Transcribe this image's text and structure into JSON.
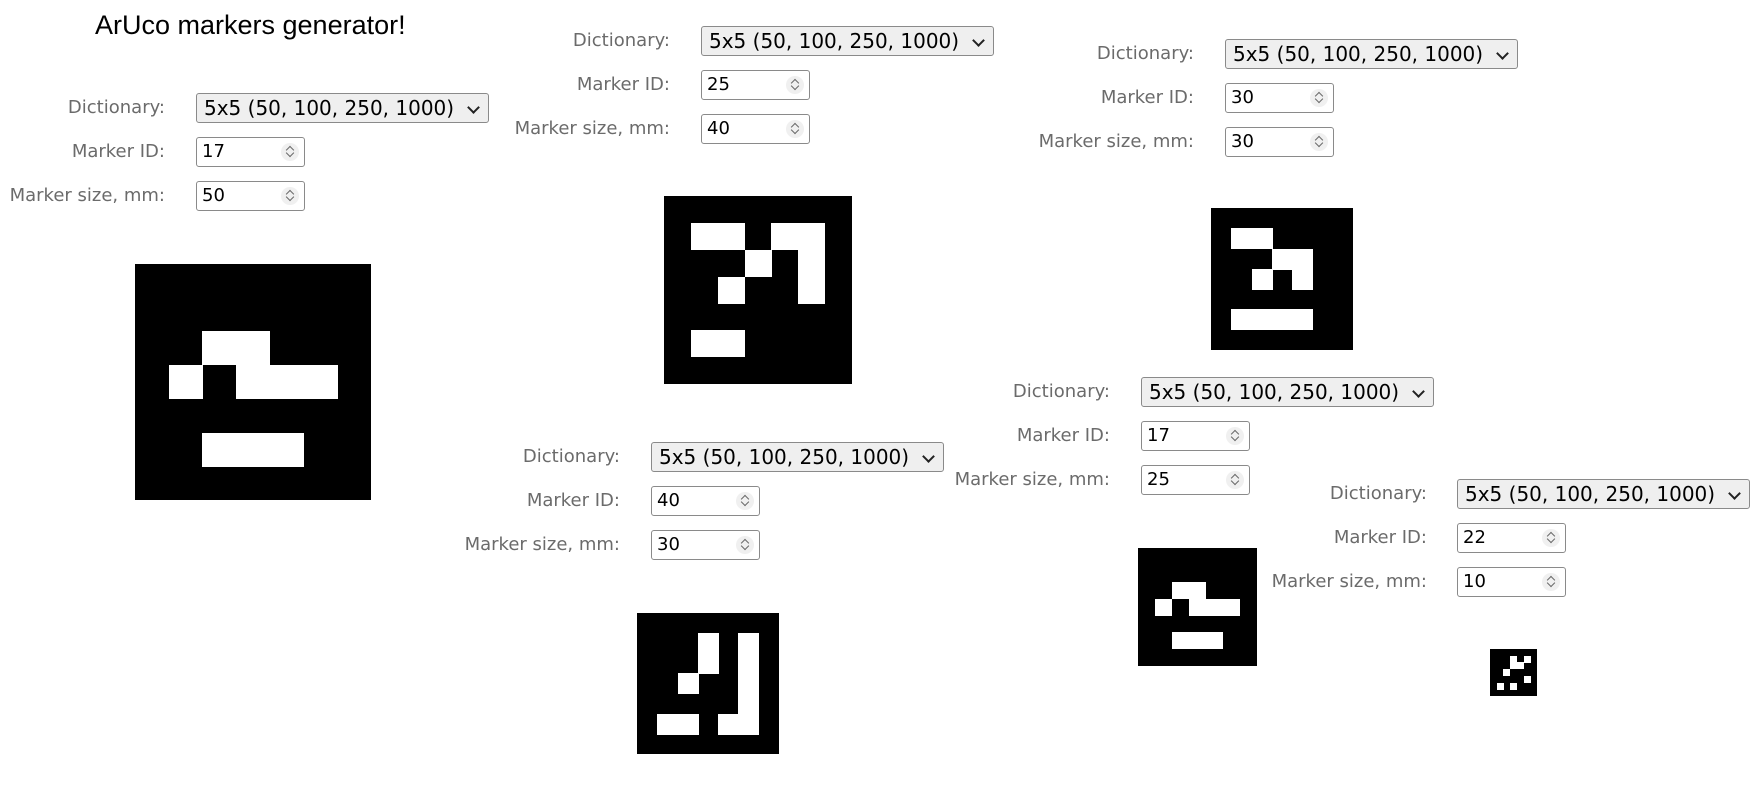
{
  "title": "ArUco markers generator!",
  "labels": {
    "dictionary": "Dictionary:",
    "marker_id": "Marker ID:",
    "marker_size": "Marker size, mm:"
  },
  "dictionary_value": "5x5 (50, 100, 250, 1000)",
  "generators": [
    {
      "marker_id": "17",
      "marker_size": "50",
      "marker_bits": [
        "00000",
        "01100",
        "10111",
        "00000",
        "01110"
      ]
    },
    {
      "marker_id": "25",
      "marker_size": "40",
      "marker_bits": [
        "11011",
        "00101",
        "01001",
        "00000",
        "11000"
      ]
    },
    {
      "marker_id": "30",
      "marker_size": "30",
      "marker_bits": [
        "11000",
        "00110",
        "01010",
        "00000",
        "11110"
      ]
    },
    {
      "marker_id": "40",
      "marker_size": "30",
      "marker_bits": [
        "00101",
        "00101",
        "01001",
        "00001",
        "11011"
      ]
    },
    {
      "marker_id": "17",
      "marker_size": "25",
      "marker_bits": [
        "00000",
        "01100",
        "10111",
        "00000",
        "01110"
      ]
    },
    {
      "marker_id": "22",
      "marker_size": "10",
      "marker_bits": [
        "00101",
        "00110",
        "01000",
        "00001",
        "10100"
      ]
    }
  ]
}
